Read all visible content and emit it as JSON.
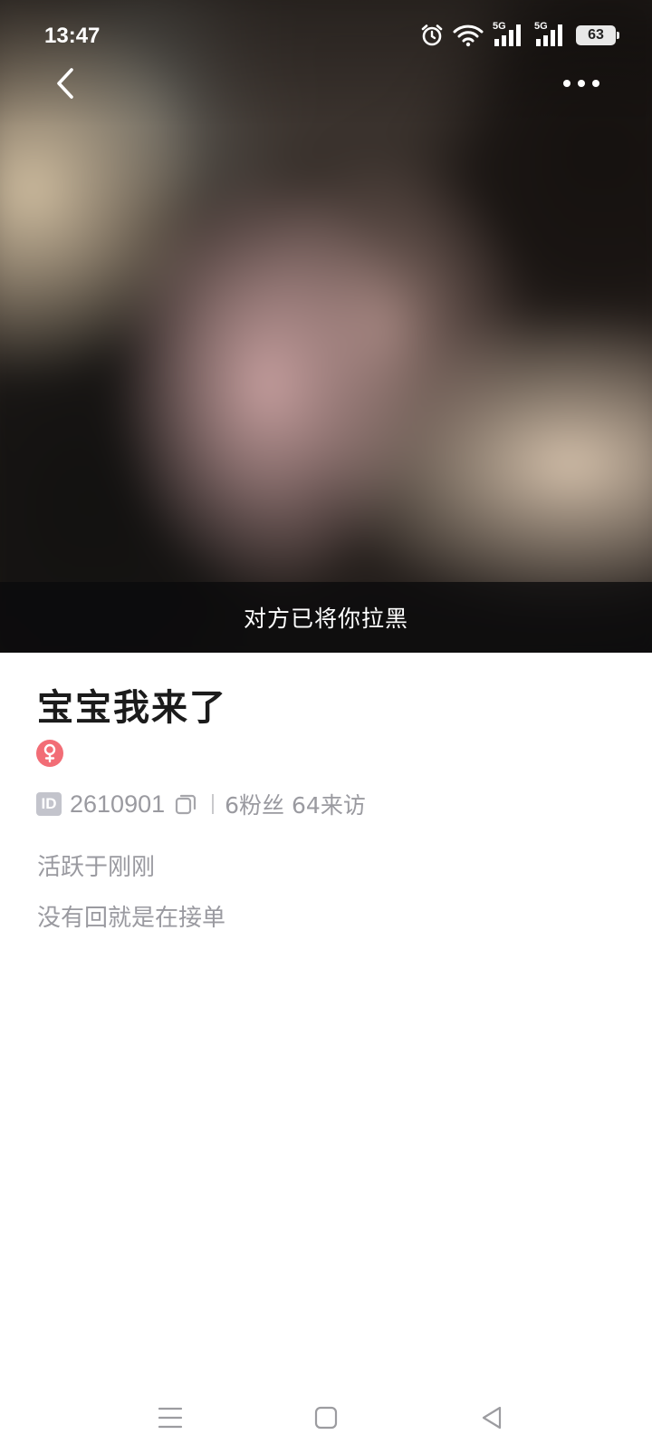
{
  "status_bar": {
    "time": "13:47",
    "battery": "63",
    "network_1": "5G",
    "network_2": "5G",
    "icons": [
      "alarm-icon",
      "wifi-icon",
      "signal-5g-icon",
      "signal-5g-icon",
      "battery-icon"
    ]
  },
  "header": {
    "back_icon": "chevron-left-icon",
    "more_icon": "more-dots-icon"
  },
  "hero": {
    "blocked_notice": "对方已将你拉黑"
  },
  "profile": {
    "nickname": "宝宝我来了",
    "gender_icon": "female-icon",
    "id_tag": "ID",
    "id_value": "2610901",
    "copy_icon": "copy-icon",
    "fans": "6粉丝",
    "visits": "64来访",
    "active_status": "活跃于刚刚",
    "bio": "没有回就是在接单"
  },
  "nav_bar": {
    "buttons": [
      "menu-icon",
      "home-square-icon",
      "back-triangle-icon"
    ]
  },
  "colors": {
    "gender_badge": "#f26d76",
    "secondary_text": "#9a9aa0",
    "title_text": "#1b1b1b",
    "id_tag_bg": "#c3c4cc"
  }
}
